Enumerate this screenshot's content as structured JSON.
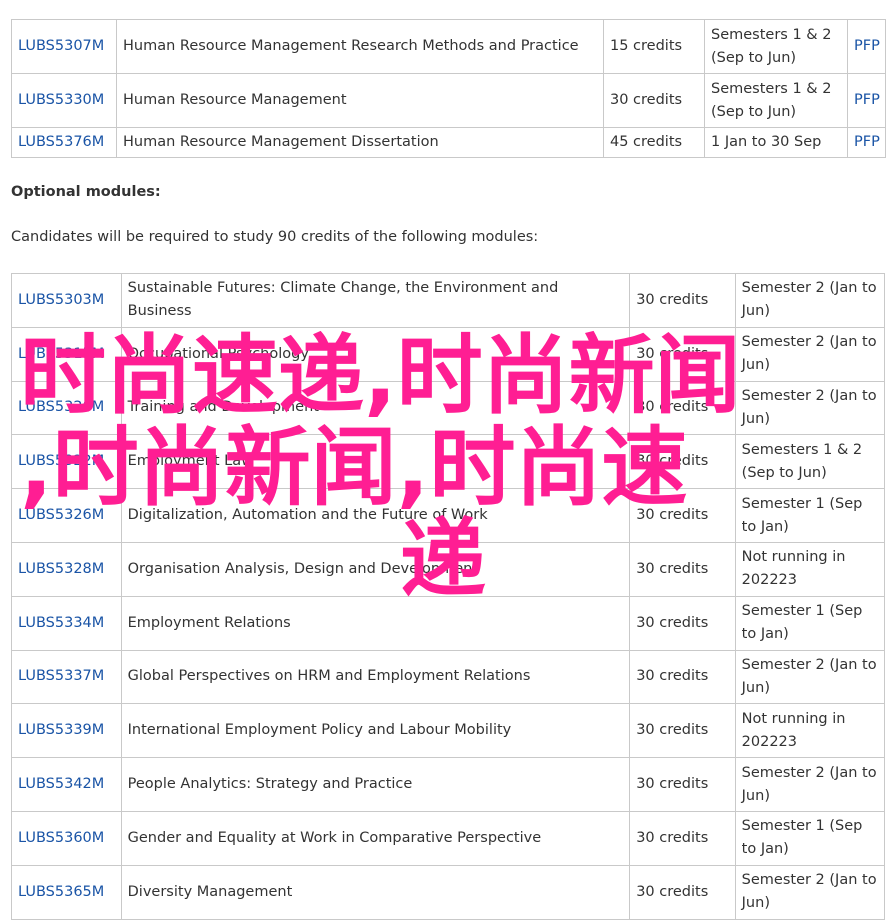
{
  "compulsory": [
    {
      "code": "LUBS5307M",
      "title": "Human Resource Management Research Methods and Practice",
      "credits": "15 credits",
      "semester": "Semesters 1 & 2 (Sep to Jun)",
      "pfp": "PFP"
    },
    {
      "code": "LUBS5330M",
      "title": "Human Resource Management",
      "credits": "30 credits",
      "semester": "Semesters 1 & 2 (Sep to Jun)",
      "pfp": "PFP"
    },
    {
      "code": "LUBS5376M",
      "title": "Human Resource Management Dissertation",
      "credits": "45 credits",
      "semester": "1 Jan to 30 Sep",
      "pfp": "PFP"
    }
  ],
  "optional_heading": "Optional modules:",
  "optional_note": "Candidates will be required to study 90 credits of the following modules:",
  "optional": [
    {
      "code": "LUBS5303M",
      "title": "Sustainable Futures: Climate Change, the Environment and Business",
      "credits": "30 credits",
      "semester": "Semester 2 (Jan to Jun)"
    },
    {
      "code": "LUBS5315M",
      "title": "Occupational Psychology",
      "credits": "30 credits",
      "semester": "Semester 2 (Jan to Jun)"
    },
    {
      "code": "LUBS5320M",
      "title": "Training and Development",
      "credits": "30 credits",
      "semester": "Semester 2 (Jan to Jun)"
    },
    {
      "code": "LUBS5322M",
      "title": "Employment Law",
      "credits": "30 credits",
      "semester": "Semesters 1 & 2 (Sep to Jun)"
    },
    {
      "code": "LUBS5326M",
      "title": "Digitalization, Automation and the Future of Work",
      "credits": "30 credits",
      "semester": "Semester 1 (Sep to Jan)"
    },
    {
      "code": "LUBS5328M",
      "title": "Organisation Analysis, Design and Development",
      "credits": "30 credits",
      "semester": "Not running in 202223"
    },
    {
      "code": "LUBS5334M",
      "title": "Employment Relations",
      "credits": "30 credits",
      "semester": "Semester 1 (Sep to Jan)"
    },
    {
      "code": "LUBS5337M",
      "title": "Global Perspectives on HRM and Employment Relations",
      "credits": "30 credits",
      "semester": "Semester 2 (Jan to Jun)"
    },
    {
      "code": "LUBS5339M",
      "title": "International Employment Policy and Labour Mobility",
      "credits": "30 credits",
      "semester": "Not running in 202223"
    },
    {
      "code": "LUBS5342M",
      "title": "People Analytics: Strategy and Practice",
      "credits": "30 credits",
      "semester": "Semester 2 (Jan to Jun)"
    },
    {
      "code": "LUBS5360M",
      "title": "Gender and Equality at Work in Comparative Perspective",
      "credits": "30 credits",
      "semester": "Semester 1 (Sep to Jan)"
    },
    {
      "code": "LUBS5365M",
      "title": "Diversity Management",
      "credits": "30 credits",
      "semester": "Semester 2 (Jan to Jun)"
    }
  ],
  "watermark": {
    "line1": "时尚速递,时尚新闻",
    "line2": ",时尚新闻,时尚速",
    "line3": "递",
    "color": "#ff1e93"
  },
  "colors": {
    "link": "#1a54a6",
    "text": "#333333",
    "border": "#c9c9c9"
  }
}
